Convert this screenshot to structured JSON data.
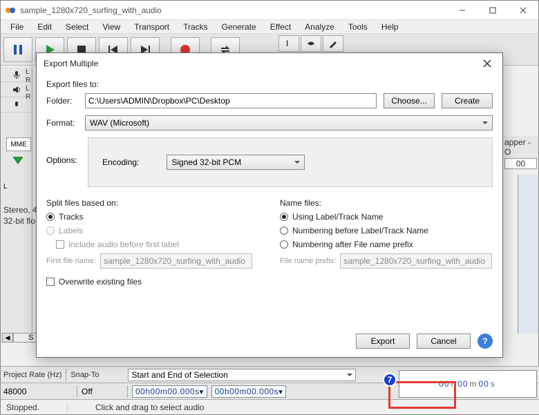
{
  "window": {
    "title": "sample_1280x720_surfing_with_audio",
    "menus": [
      "File",
      "Edit",
      "Select",
      "View",
      "Transport",
      "Tracks",
      "Generate",
      "Effect",
      "Analyze",
      "Tools",
      "Help"
    ]
  },
  "track": {
    "label_l": "L",
    "label_r": "R",
    "mme": "MME",
    "info1": "Stereo, 4",
    "info2": "32-bit flo",
    "wave_l": "L",
    "mapper": "apper - O",
    "zero": "00"
  },
  "dialog": {
    "title": "Export Multiple",
    "export_to": "Export files to:",
    "folder_label": "Folder:",
    "folder_value": "C:\\Users\\ADMIN\\Dropbox\\PC\\Desktop",
    "choose": "Choose...",
    "create": "Create",
    "format_label": "Format:",
    "format_value": "WAV (Microsoft)",
    "options_label": "Options:",
    "encoding_label": "Encoding:",
    "encoding_value": "Signed 32-bit PCM",
    "split_label": "Split files based on:",
    "split_tracks": "Tracks",
    "split_labels": "Labels",
    "include_audio": "Include audio before first label",
    "first_file_label": "First file name:",
    "first_file_value": "sample_1280x720_surfing_with_audio",
    "name_label": "Name files:",
    "name_opt1": "Using Label/Track Name",
    "name_opt2": "Numbering before Label/Track Name",
    "name_opt3": "Numbering after File name prefix",
    "prefix_label": "File name prefix:",
    "prefix_value": "sample_1280x720_surfing_with_audio",
    "overwrite": "Overwrite existing files",
    "export": "Export",
    "cancel": "Cancel",
    "help": "?"
  },
  "status": {
    "project_rate": "Project Rate (Hz)",
    "rate_value": "48000",
    "snap": "Snap-To",
    "snap_value": "Off",
    "selection_label": "Start and End of Selection",
    "time1": "00h00m00.000s",
    "time2": "00h00m00.000s",
    "bigtime": "00 h 00 m 00 s",
    "stopped": "Stopped.",
    "hint": "Click and drag to select audio",
    "scroll_label": "S"
  },
  "anno": {
    "num": "7"
  }
}
